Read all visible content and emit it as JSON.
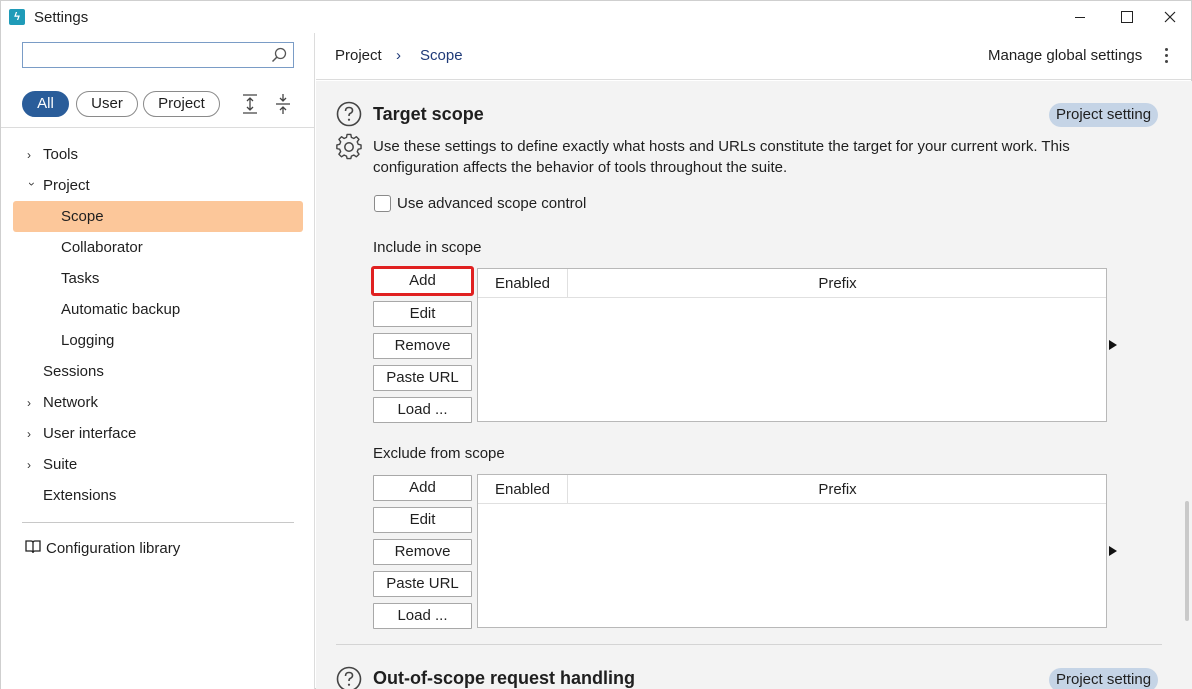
{
  "window": {
    "title": "Settings"
  },
  "search": {
    "placeholder": "",
    "value": ""
  },
  "filters": [
    {
      "label": "All",
      "active": true
    },
    {
      "label": "User",
      "active": false
    },
    {
      "label": "Project",
      "active": false
    }
  ],
  "nav": {
    "tools": "Tools",
    "project": "Project",
    "scope": "Scope",
    "collaborator": "Collaborator",
    "tasks": "Tasks",
    "automatic_backup": "Automatic backup",
    "logging": "Logging",
    "sessions": "Sessions",
    "network": "Network",
    "user_interface": "User interface",
    "suite": "Suite",
    "extensions": "Extensions",
    "configuration_library": "Configuration library"
  },
  "breadcrumb": {
    "parent": "Project",
    "separator": "›",
    "current": "Scope"
  },
  "header": {
    "manage_global": "Manage global settings"
  },
  "target_scope": {
    "title": "Target scope",
    "badge": "Project setting",
    "description": "Use these settings to define exactly what hosts and URLs constitute the target for your current work. This configuration affects the behavior of tools throughout the suite.",
    "advanced_checkbox": {
      "label": "Use advanced scope control",
      "checked": false
    },
    "include": {
      "label": "Include in scope",
      "buttons": {
        "add": "Add",
        "edit": "Edit",
        "remove": "Remove",
        "paste_url": "Paste URL",
        "load": "Load ..."
      },
      "columns": {
        "enabled": "Enabled",
        "prefix": "Prefix"
      }
    },
    "exclude": {
      "label": "Exclude from scope",
      "buttons": {
        "add": "Add",
        "edit": "Edit",
        "remove": "Remove",
        "paste_url": "Paste URL",
        "load": "Load ..."
      },
      "columns": {
        "enabled": "Enabled",
        "prefix": "Prefix"
      }
    }
  },
  "out_of_scope": {
    "title": "Out-of-scope request handling",
    "badge": "Project setting"
  },
  "colors": {
    "accent_selected": "#fcc79a",
    "active_pill": "#2a5d9a",
    "badge_bg": "#c5d4e6",
    "highlight_border": "#e02020"
  }
}
